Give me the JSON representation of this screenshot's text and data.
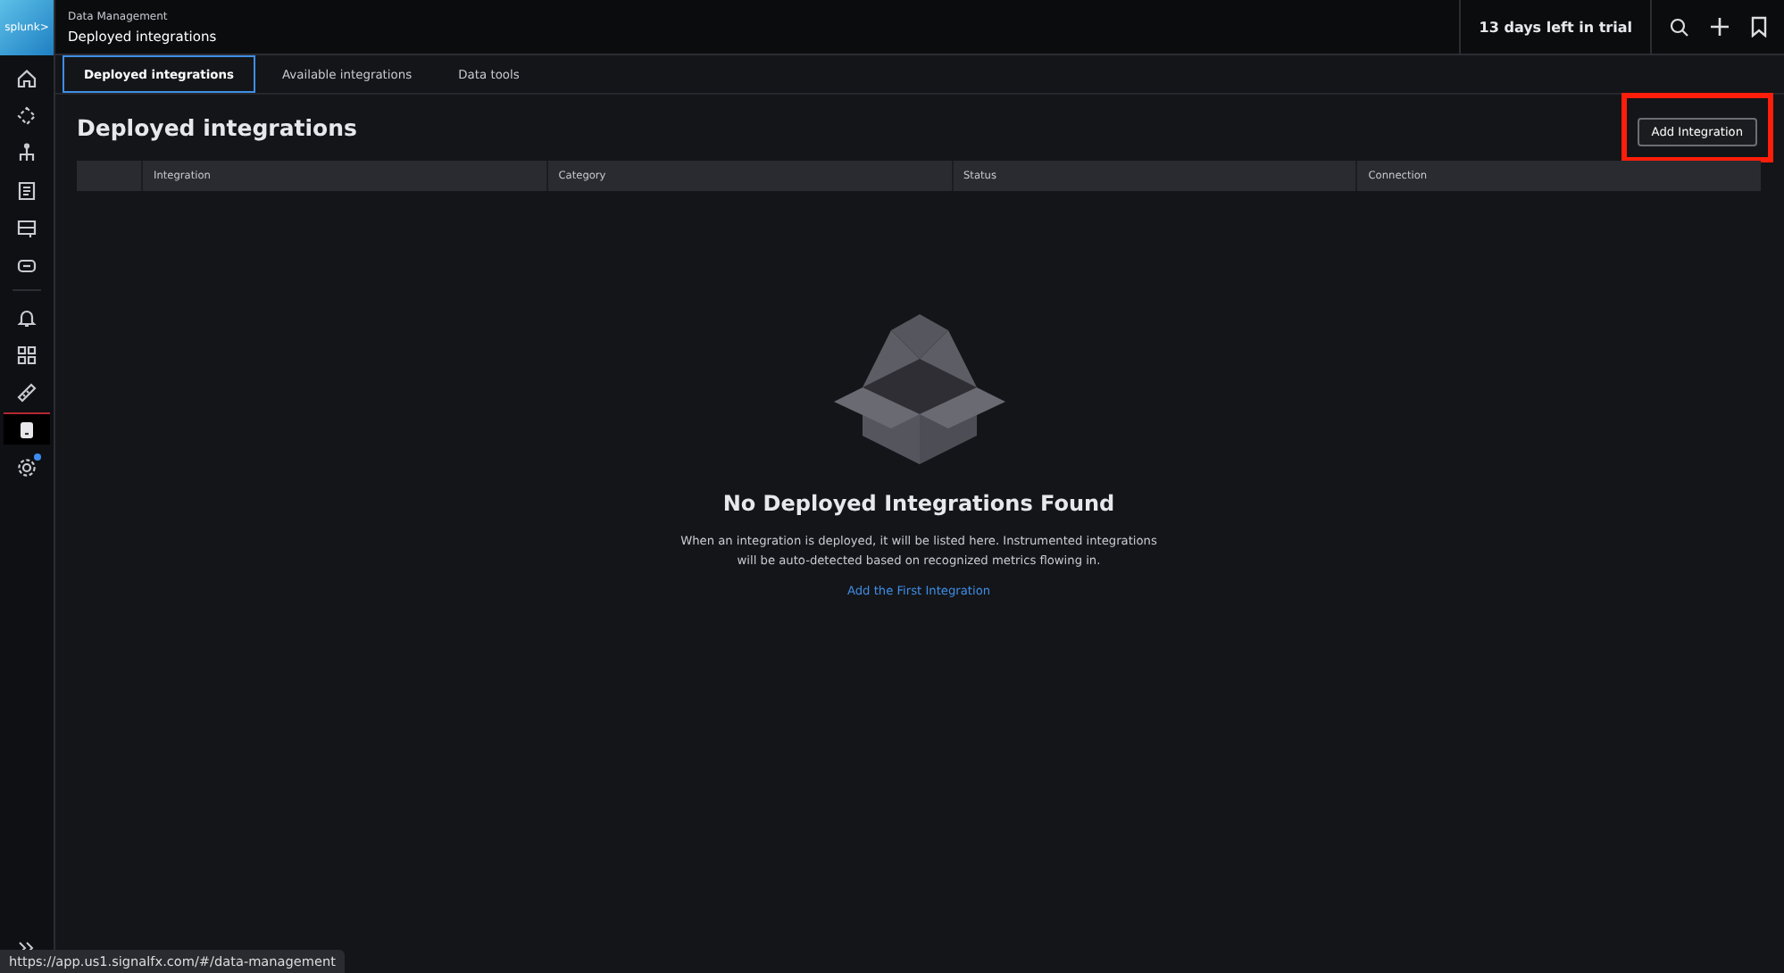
{
  "logo": {
    "text": "splunk>"
  },
  "header": {
    "breadcrumb": "Data Management",
    "title": "Deployed integrations",
    "trial": "13 days left in trial"
  },
  "sidebar": {
    "groups": [
      [
        {
          "kind": "home",
          "selected": false,
          "badge": false
        },
        {
          "kind": "nodes",
          "selected": false,
          "badge": false
        },
        {
          "kind": "hierarchy",
          "selected": false,
          "badge": false
        },
        {
          "kind": "document",
          "selected": false,
          "badge": false
        },
        {
          "kind": "server",
          "selected": false,
          "badge": false
        },
        {
          "kind": "robot",
          "selected": false,
          "badge": false
        }
      ],
      [
        {
          "kind": "bell",
          "selected": false,
          "badge": false
        },
        {
          "kind": "grid",
          "selected": false,
          "badge": false
        },
        {
          "kind": "ruler",
          "selected": false,
          "badge": false
        },
        {
          "kind": "database",
          "selected": true,
          "badge": false
        },
        {
          "kind": "gear",
          "selected": false,
          "badge": true
        }
      ]
    ]
  },
  "tabs": [
    {
      "label": "Deployed integrations",
      "selected": true
    },
    {
      "label": "Available integrations",
      "selected": false
    },
    {
      "label": "Data tools",
      "selected": false
    }
  ],
  "page": {
    "title": "Deployed integrations",
    "add_button": "Add Integration",
    "highlighted": true
  },
  "table": {
    "columns": [
      "Integration",
      "Category",
      "Status",
      "Connection"
    ]
  },
  "empty_state": {
    "title": "No Deployed Integrations Found",
    "text": "When an integration is deployed, it will be listed here. Instrumented integrations will be auto-detected based on recognized metrics flowing in.",
    "link": "Add the First Integration"
  },
  "status_url": "https://app.us1.signalfx.com/#/data-management"
}
